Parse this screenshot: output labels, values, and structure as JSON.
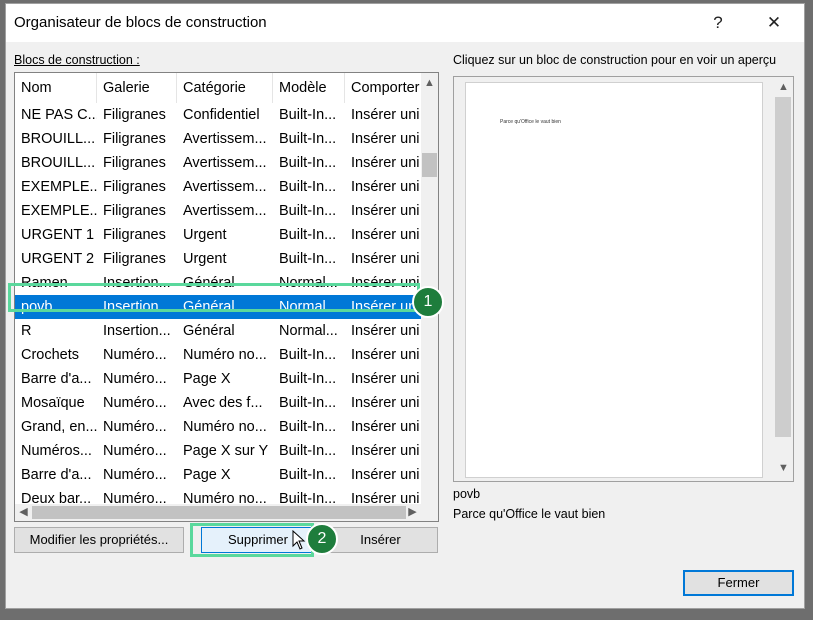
{
  "dialog": {
    "title": "Organisateur de blocs de construction",
    "help_label": "?",
    "close_label": "✕"
  },
  "list": {
    "label": "Blocs de construction :",
    "columns": [
      "Nom",
      "Galerie",
      "Catégorie",
      "Modèle",
      "Comporter"
    ],
    "rows": [
      [
        "NE PAS C...",
        "Filigranes",
        "Confidentiel",
        "Built-In...",
        "Insérer uni"
      ],
      [
        "BROUILL...",
        "Filigranes",
        "Avertissem...",
        "Built-In...",
        "Insérer uni"
      ],
      [
        "BROUILL...",
        "Filigranes",
        "Avertissem...",
        "Built-In...",
        "Insérer uni"
      ],
      [
        "EXEMPLE...",
        "Filigranes",
        "Avertissem...",
        "Built-In...",
        "Insérer uni"
      ],
      [
        "EXEMPLE...",
        "Filigranes",
        "Avertissem...",
        "Built-In...",
        "Insérer uni"
      ],
      [
        "URGENT 1",
        "Filigranes",
        "Urgent",
        "Built-In...",
        "Insérer uni"
      ],
      [
        "URGENT 2",
        "Filigranes",
        "Urgent",
        "Built-In...",
        "Insérer uni"
      ],
      [
        "Ramen",
        "Insertion...",
        "Général",
        "Normal...",
        "Insérer uni"
      ],
      [
        "povb",
        "Insertion...",
        "Général",
        "Normal...",
        "Insérer uni"
      ],
      [
        "R",
        "Insertion...",
        "Général",
        "Normal...",
        "Insérer uni"
      ],
      [
        "Crochets",
        "Numéro...",
        "Numéro no...",
        "Built-In...",
        "Insérer uni"
      ],
      [
        "Barre d'a...",
        "Numéro...",
        "Page X",
        "Built-In...",
        "Insérer uni"
      ],
      [
        "Mosaïque",
        "Numéro...",
        "Avec des f...",
        "Built-In...",
        "Insérer uni"
      ],
      [
        "Grand, en...",
        "Numéro...",
        "Numéro no...",
        "Built-In...",
        "Insérer uni"
      ],
      [
        "Numéros...",
        "Numéro...",
        "Page X sur Y",
        "Built-In...",
        "Insérer uni"
      ],
      [
        "Barre d'a...",
        "Numéro...",
        "Page X",
        "Built-In...",
        "Insérer uni"
      ],
      [
        "Deux bar...",
        "Numéro...",
        "Numéro no...",
        "Built-In...",
        "Insérer uni"
      ]
    ],
    "selected_index": 8
  },
  "preview": {
    "label": "Cliquez sur un bloc de construction pour en voir un aperçu",
    "page_text": "Parce qu'Office le vaut bien",
    "name": "povb",
    "description": "Parce qu'Office le vaut bien"
  },
  "buttons": {
    "modify": "Modifier les propriétés...",
    "delete": "Supprimer",
    "insert": "Insérer",
    "close": "Fermer"
  },
  "callouts": {
    "one": "1",
    "two": "2"
  },
  "colors": {
    "selection": "#0078d7",
    "highlight": "#5ad89c",
    "badge": "#1e7d3c"
  }
}
